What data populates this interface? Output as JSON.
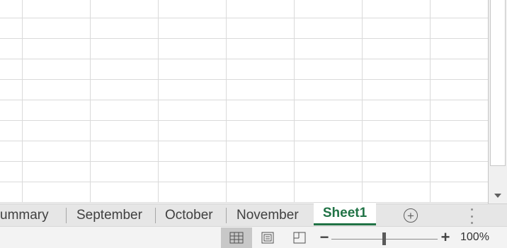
{
  "sheet_tabs": {
    "items": [
      {
        "label": "ummary"
      },
      {
        "label": "September"
      },
      {
        "label": "October"
      },
      {
        "label": "November"
      }
    ],
    "active": "Sheet1",
    "add_sheet_symbol": "+"
  },
  "status_bar": {
    "view_modes": [
      "normal-view-icon",
      "page-layout-icon",
      "page-break-preview-icon"
    ],
    "active_view": "normal-view-icon",
    "zoom_minus": "−",
    "zoom_plus": "+",
    "zoom_level": "100%",
    "zoom_percent": 100
  },
  "colors": {
    "active_tab": "#217346",
    "gridline": "#dadada",
    "tab_bar": "#e6e6e6"
  }
}
